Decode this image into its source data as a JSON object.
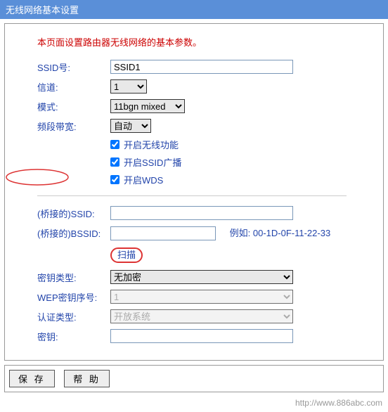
{
  "titlebar": "无线网络基本设置",
  "intro": "本页面设置路由器无线网络的基本参数。",
  "labels": {
    "ssid": "SSID号:",
    "channel": "信道:",
    "mode": "模式:",
    "bandwidth": "频段带宽:",
    "br_ssid": "(桥接的)SSID:",
    "br_bssid": "(桥接的)BSSID:",
    "enc_type": "密钥类型:",
    "wep_idx": "WEP密钥序号:",
    "auth_type": "认证类型:",
    "key": "密钥:"
  },
  "values": {
    "ssid": "SSID1",
    "channel": "1",
    "mode": "11bgn mixed",
    "bandwidth": "自动",
    "br_ssid": "",
    "br_bssid": "",
    "enc_type": "无加密",
    "wep_idx": "1",
    "auth_type": "开放系统",
    "key": ""
  },
  "checks": {
    "enable_wifi": "开启无线功能",
    "enable_ssid_broadcast": "开启SSID广播",
    "enable_wds": "开启WDS"
  },
  "check_state": {
    "enable_wifi": true,
    "enable_ssid_broadcast": true,
    "enable_wds": true
  },
  "bssid_hint_prefix": "例如:",
  "bssid_hint_value": "00-1D-0F-11-22-33",
  "scan_btn": "扫描",
  "footer": {
    "save": "保 存",
    "help": "帮 助"
  },
  "watermark": "http://www.886abc.com"
}
